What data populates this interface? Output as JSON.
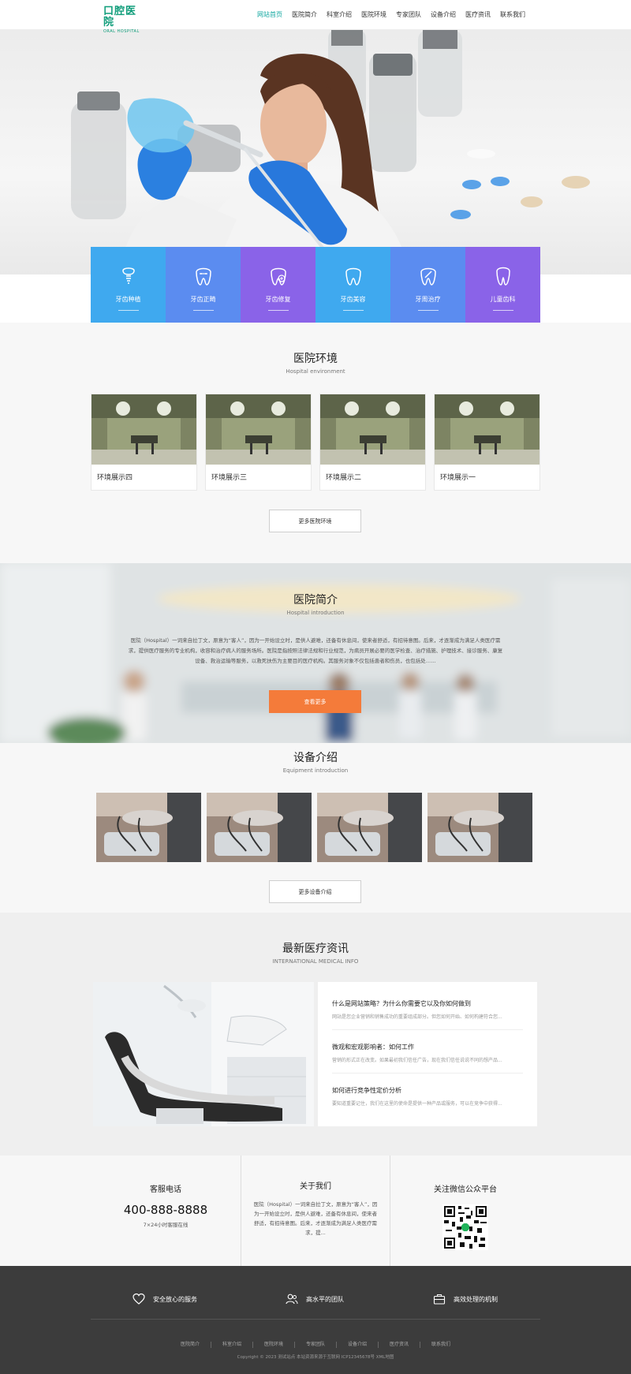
{
  "header": {
    "logo_cn": "口腔医院",
    "logo_en": "ORAL HOSPITAL",
    "nav": [
      "网站首页",
      "医院简介",
      "科室介绍",
      "医院环境",
      "专家团队",
      "设备介绍",
      "医疗资讯",
      "联系我们"
    ]
  },
  "services": [
    {
      "label": "牙齿种植",
      "color": "#3fa9ef",
      "icon": "implant-icon"
    },
    {
      "label": "牙齿正畸",
      "color": "#5b8cf0",
      "icon": "braces-icon"
    },
    {
      "label": "牙齿修复",
      "color": "#8a63e8",
      "icon": "repair-icon"
    },
    {
      "label": "牙齿美容",
      "color": "#3fa9ef",
      "icon": "tooth-icon"
    },
    {
      "label": "牙周治疗",
      "color": "#5b8cf0",
      "icon": "treatment-icon"
    },
    {
      "label": "儿童齿科",
      "color": "#8a63e8",
      "icon": "kids-tooth-icon"
    }
  ],
  "environment": {
    "title": "医院环境",
    "subtitle": "Hospital environment",
    "cards": [
      "环境展示四",
      "环境展示三",
      "环境展示二",
      "环境展示一"
    ],
    "more": "更多医院环境"
  },
  "intro": {
    "title": "医院简介",
    "subtitle": "Hospital introduction",
    "text": "医院（Hospital）一词来自拉丁文，原意为“客人”，因为一开始设立时，是供人避难，还备有休息间，使来者舒适，有招待意图。后来，才逐渐成为满足人类医疗需求，提供医疗服务的专业机构，收容和治疗病人的服务场所。医院是指按照法律法规和行业规范，为病员开展必要的医学检查、治疗措施、护理技术、接诊服务、康复设备、救治运输等服务，以救死扶伤为主要目的医疗机构。其服务对象不仅包括患者和伤员，也包括处……",
    "button": "查看更多"
  },
  "equipment": {
    "title": "设备介绍",
    "subtitle": "Equipment introduction",
    "more": "更多设备介绍"
  },
  "news": {
    "title": "最新医疗资讯",
    "subtitle": "INTERNATIONAL MEDICAL INFO",
    "items": [
      {
        "title": "什么是网站策略？为什么你需要它以及你如何做到",
        "desc": "网站是您企业营销和销售成功的重要组成部分。但您如何开始、如何构建符合您..."
      },
      {
        "title": "微观和宏观影响者：如何工作",
        "desc": "营销的形式正在改变。如果最初我们信任广告，现在我们信任说说不同的想产品..."
      },
      {
        "title": "如何进行竞争性定价分析",
        "desc": "要知道重要记住，我们在这里的使命是提供一种产品或服务，可以在竞争中获得..."
      }
    ]
  },
  "contact": {
    "service_title": "客服电话",
    "phone": "400-888-8888",
    "hours": "7×24小时客服在线",
    "about_title": "关于我们",
    "about_text": "医院（Hospital）一词来自拉丁文，原意为“客人”，因为一开始设立时，是供人避难，还备有休息间，使来者舒适，有招待意图。后来，才逐渐成为满足人类医疗需求，提...",
    "wechat_title": "关注微信公众平台"
  },
  "footer": {
    "features": [
      {
        "label": "安全放心的服务",
        "icon": "heart-icon"
      },
      {
        "label": "高水平的团队",
        "icon": "team-icon"
      },
      {
        "label": "高效处理的机制",
        "icon": "briefcase-icon"
      }
    ],
    "links": [
      "医院简介",
      "科室介绍",
      "医院环境",
      "专家团队",
      "设备介绍",
      "医疗资讯",
      "联系我们"
    ],
    "copyright": "Copyright © 2023 测试站点 本站资源来源于互联网 ICP12345678号 XML地图"
  }
}
